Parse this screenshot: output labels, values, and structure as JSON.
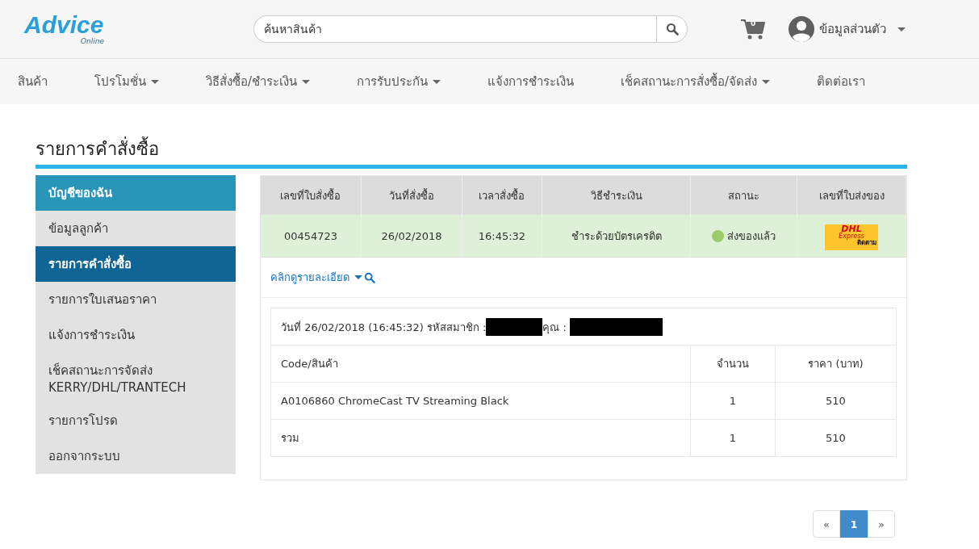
{
  "header": {
    "logo": {
      "name": "Advice",
      "tagline": "Online"
    },
    "search": {
      "placeholder": "ค้นหาสินค้า"
    },
    "cart": {
      "count": "0"
    },
    "account": {
      "label": "ข้อมูลส่วนตัว"
    }
  },
  "nav": [
    {
      "label": "สินค้า",
      "dropdown": false
    },
    {
      "label": "โปรโมชั่น",
      "dropdown": true
    },
    {
      "label": "วิธีสั่งซื้อ/ชำระเงิน",
      "dropdown": true
    },
    {
      "label": "การรับประกัน",
      "dropdown": true
    },
    {
      "label": "แจ้งการชำระเงิน",
      "dropdown": false
    },
    {
      "label": "เช็คสถานะการสั่งซื้อ/จัดส่ง",
      "dropdown": true
    },
    {
      "label": "ติดต่อเรา",
      "dropdown": false
    }
  ],
  "page_title": "รายการคำสั่งซื้อ",
  "sidebar": {
    "items": [
      {
        "label": "บัญชีของฉัน",
        "kind": "header",
        "selected": false
      },
      {
        "label": "ข้อมูลลูกค้า",
        "kind": "link",
        "selected": false
      },
      {
        "label": "รายการคำสั่งซื้อ",
        "kind": "link",
        "selected": true
      },
      {
        "label": "รายการใบเสนอราคา",
        "kind": "link",
        "selected": false
      },
      {
        "label": "แจ้งการชำระเงิน",
        "kind": "link",
        "selected": false
      },
      {
        "label": "เช็คสถานะการจัดส่ง KERRY/DHL/TRANTECH",
        "kind": "link",
        "selected": false
      },
      {
        "label": "รายการโปรด",
        "kind": "link",
        "selected": false
      },
      {
        "label": "ออกจากระบบ",
        "kind": "link",
        "selected": false
      }
    ]
  },
  "order_table": {
    "columns": [
      "เลขที่ใบสั่งซื้อ",
      "วันที่สั่งซื้อ",
      "เวลาสั่งซื้อ",
      "วิธีชำระเงิน",
      "สถานะ",
      "เลขที่ใบส่งของ"
    ],
    "rows": [
      {
        "order_no": "00454723",
        "date": "26/02/2018",
        "time": "16:45:32",
        "payment": "ชำระด้วยบัตรเครดิต",
        "status": {
          "label": "ส่งของแล้ว",
          "color": "#9acd68"
        },
        "tracking": {
          "carrier": "DHL",
          "service": "Express",
          "action": "ติดตาม"
        }
      }
    ]
  },
  "details_link": "คลิกดูรายละเอียด",
  "detail": {
    "info": {
      "date_label": "วันที่ 26/02/2018 (16:45:32) รหัสสมาชิก :",
      "name_label": "คุณ :"
    },
    "columns": [
      "Code/สินค้า",
      "จำนวน",
      "ราคา (บาท)"
    ],
    "rows": [
      {
        "item": "A0106860 ChromeCast TV Streaming Black",
        "qty": "1",
        "price": "510"
      },
      {
        "item": "รวม",
        "qty": "1",
        "price": "510"
      }
    ]
  },
  "pagination": {
    "prev": "«",
    "pages": [
      {
        "label": "1",
        "selected": true
      }
    ],
    "next": "»"
  }
}
